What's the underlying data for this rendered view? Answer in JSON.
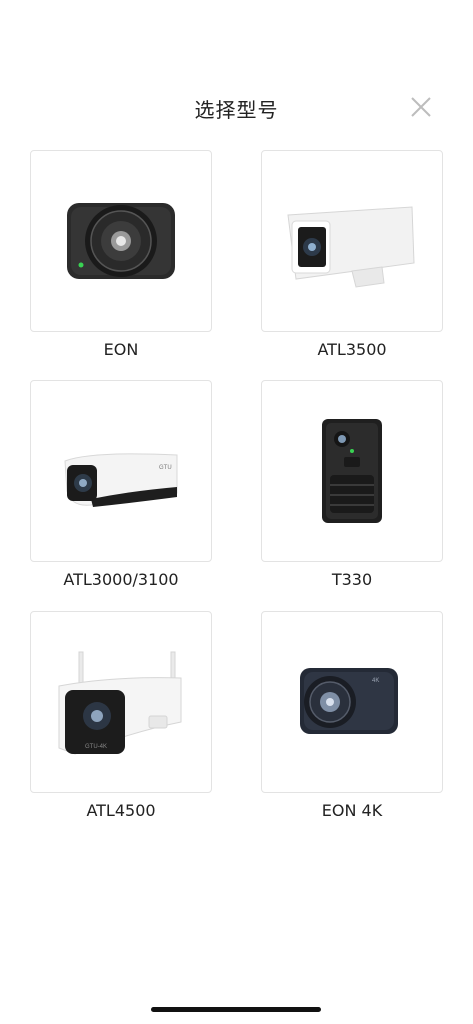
{
  "header": {
    "title": "选择型号",
    "close_icon": "close-icon"
  },
  "models": [
    {
      "label": "EON"
    },
    {
      "label": "ATL3500"
    },
    {
      "label": "ATL3000/3100"
    },
    {
      "label": "T330"
    },
    {
      "label": "ATL4500"
    },
    {
      "label": "EON 4K"
    }
  ],
  "colors": {
    "text": "#222222",
    "card_border": "#e3e3e3",
    "close_icon": "#bdbdbd",
    "camera_dark": "#2a2a2a"
  }
}
